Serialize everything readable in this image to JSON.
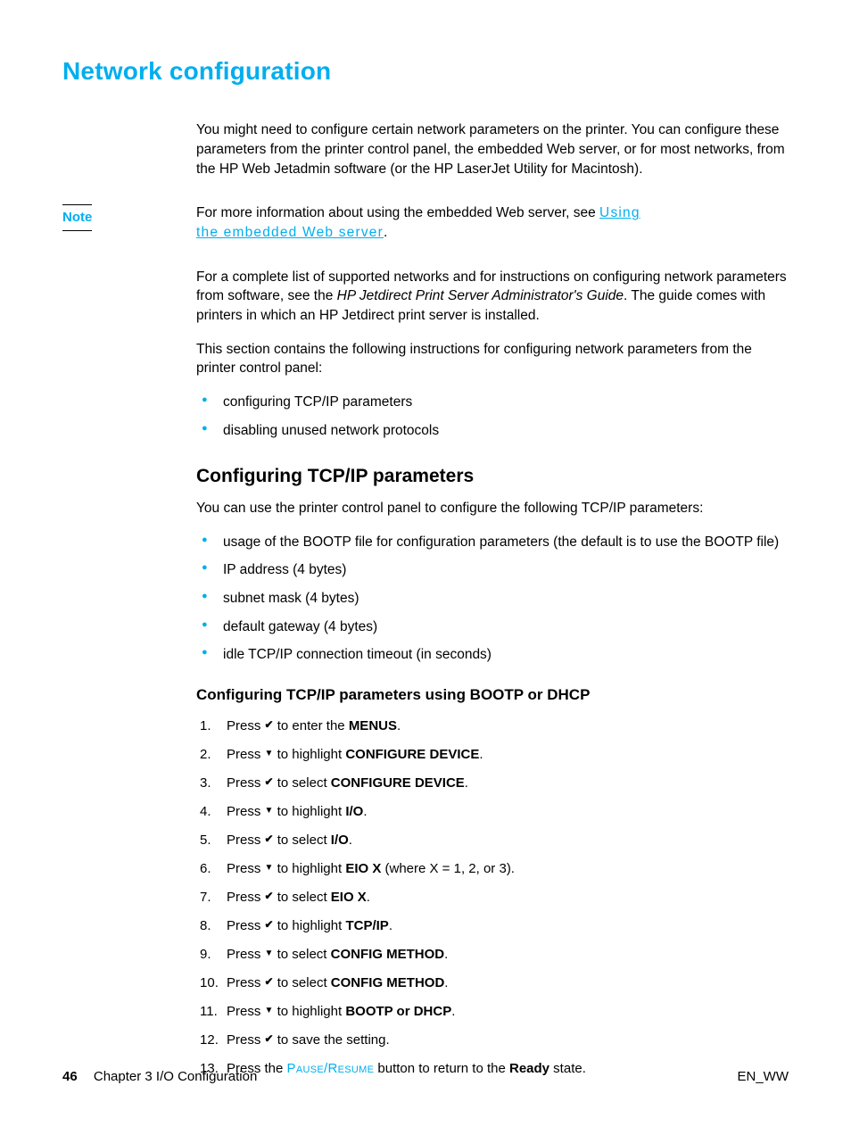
{
  "title": "Network configuration",
  "intro": "You might need to configure certain network parameters on the printer. You can configure these parameters from the printer control panel, the embedded Web server, or for most networks, from the HP Web Jetadmin software (or the HP LaserJet Utility for Macintosh).",
  "note": {
    "label": "Note",
    "pre": "For more information about using the embedded Web server, see ",
    "link1": "Using",
    "link2": "the embedded Web server",
    "post": "."
  },
  "para2a": "For a complete list of supported networks and for instructions on configuring network parameters from software, see the ",
  "para2b": "HP Jetdirect Print Server Administrator's Guide",
  "para2c": ". The guide comes with printers in which an HP Jetdirect print server is installed.",
  "para3": "This section contains the following instructions for configuring network parameters from the printer control panel:",
  "list1": [
    "configuring TCP/IP parameters",
    "disabling unused network protocols"
  ],
  "h2": "Configuring TCP/IP parameters",
  "h2intro": "You can use the printer control panel to configure the following TCP/IP parameters:",
  "list2": [
    "usage of the BOOTP file for configuration parameters (the default is to use the BOOTP file)",
    "IP address (4 bytes)",
    "subnet mask (4 bytes)",
    "default gateway (4 bytes)",
    "idle TCP/IP connection timeout (in seconds)"
  ],
  "h3": "Configuring TCP/IP parameters using BOOTP or DHCP",
  "steps": [
    {
      "pre": "Press ",
      "icon": "check",
      "mid": " to enter the ",
      "bold": "MENUS",
      "post": "."
    },
    {
      "pre": "Press ",
      "icon": "down",
      "mid": " to highlight ",
      "bold": "CONFIGURE DEVICE",
      "post": "."
    },
    {
      "pre": "Press ",
      "icon": "check",
      "mid": " to select ",
      "bold": "CONFIGURE DEVICE",
      "post": "."
    },
    {
      "pre": "Press ",
      "icon": "down",
      "mid": " to highlight ",
      "bold": "I/O",
      "post": "."
    },
    {
      "pre": "Press ",
      "icon": "check",
      "mid": " to select ",
      "bold": "I/O",
      "post": "."
    },
    {
      "pre": "Press ",
      "icon": "down",
      "mid": " to highlight ",
      "bold": "EIO X",
      "post": " (where X = 1, 2, or 3)."
    },
    {
      "pre": "Press ",
      "icon": "check",
      "mid": " to select ",
      "bold": "EIO X",
      "post": "."
    },
    {
      "pre": "Press ",
      "icon": "check",
      "mid": " to highlight ",
      "bold": "TCP/IP",
      "post": "."
    },
    {
      "pre": "Press ",
      "icon": "down",
      "mid": " to select ",
      "bold": "CONFIG METHOD",
      "post": "."
    },
    {
      "pre": "Press ",
      "icon": "check",
      "mid": " to select ",
      "bold": "CONFIG METHOD",
      "post": "."
    },
    {
      "pre": "Press ",
      "icon": "down",
      "mid": " to highlight ",
      "bold": "BOOTP or DHCP",
      "post": "."
    },
    {
      "pre": "Press ",
      "icon": "check",
      "mid": " to save the setting.",
      "bold": "",
      "post": ""
    },
    {
      "pre": "Press the ",
      "icon": "",
      "mid": "",
      "bold": "",
      "post": "",
      "pause": true,
      "pauseText": "Pause/Resume",
      "post2": " button to return to the ",
      "bold2": "Ready",
      "post3": " state."
    }
  ],
  "footer": {
    "page": "46",
    "chapter": "Chapter 3 I/O Configuration",
    "right": "EN_WW"
  }
}
